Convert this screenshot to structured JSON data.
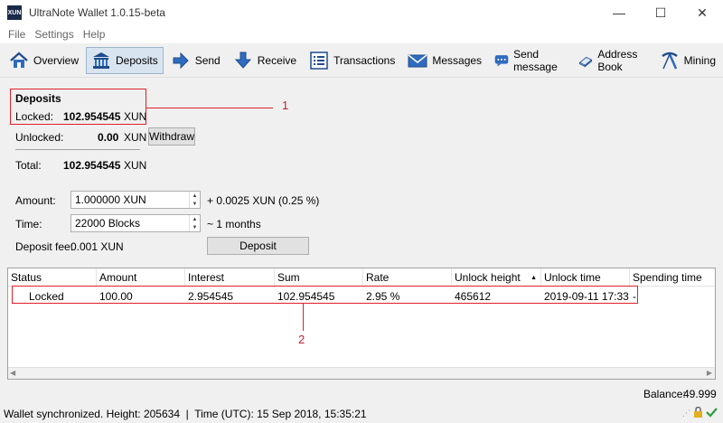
{
  "window": {
    "title": "UltraNote Wallet 1.0.15-beta",
    "app_icon_text": "XUN",
    "minimize": "—",
    "maximize": "☐",
    "close": "✕"
  },
  "menu": [
    "File",
    "Settings",
    "Help"
  ],
  "toolbar": [
    {
      "label": "Overview",
      "icon": "home-icon"
    },
    {
      "label": "Deposits",
      "icon": "bank-icon",
      "active": true
    },
    {
      "label": "Send",
      "icon": "send-arrow-icon"
    },
    {
      "label": "Receive",
      "icon": "receive-arrow-icon"
    },
    {
      "label": "Transactions",
      "icon": "list-icon"
    },
    {
      "label": "Messages",
      "icon": "envelope-icon"
    },
    {
      "label": "Send message",
      "icon": "chat-bubble-icon"
    },
    {
      "label": "Address Book",
      "icon": "book-icon"
    },
    {
      "label": "Mining",
      "icon": "pickaxe-icon"
    }
  ],
  "deposits": {
    "heading": "Deposits",
    "locked_label": "Locked:",
    "locked_value": "102.954545",
    "locked_unit": "XUN",
    "unlocked_label": "Unlocked:",
    "unlocked_value": "0.00",
    "unlocked_unit": "XUN",
    "withdraw_label": "Withdraw",
    "total_label": "Total:",
    "total_value": "102.954545",
    "total_unit": "XUN"
  },
  "form": {
    "amount_label": "Amount:",
    "amount_value": "1.000000 XUN",
    "amount_note": "+ 0.0025 XUN (0.25 %)",
    "time_label": "Time:",
    "time_value": "22000 Blocks",
    "time_note": "~ 1 months",
    "fee_label": "Deposit fee:",
    "fee_value": "0.001 XUN",
    "deposit_button": "Deposit"
  },
  "annotations": {
    "one": "1",
    "two": "2"
  },
  "table": {
    "columns": [
      "Status",
      "Amount",
      "Interest",
      "Sum",
      "Rate",
      "Unlock height",
      "Unlock time",
      "Spending time"
    ],
    "sort_indicator": "▲",
    "rows": [
      {
        "status": "Locked",
        "amount": "100.00",
        "interest": "2.954545",
        "sum": "102.954545",
        "rate": "2.95 %",
        "unlock_height": "465612",
        "unlock_time": "2019-09-11 17:33",
        "spending_time": "-"
      }
    ]
  },
  "balance": {
    "label": "Balance:",
    "value": "49.999"
  },
  "status": {
    "text": "Wallet synchronized. Height: 205634  |  Time (UTC): 15 Sep 2018, 15:35:21",
    "icons": [
      "resize-grip-icon",
      "lock-icon",
      "checkmark-icon"
    ]
  }
}
